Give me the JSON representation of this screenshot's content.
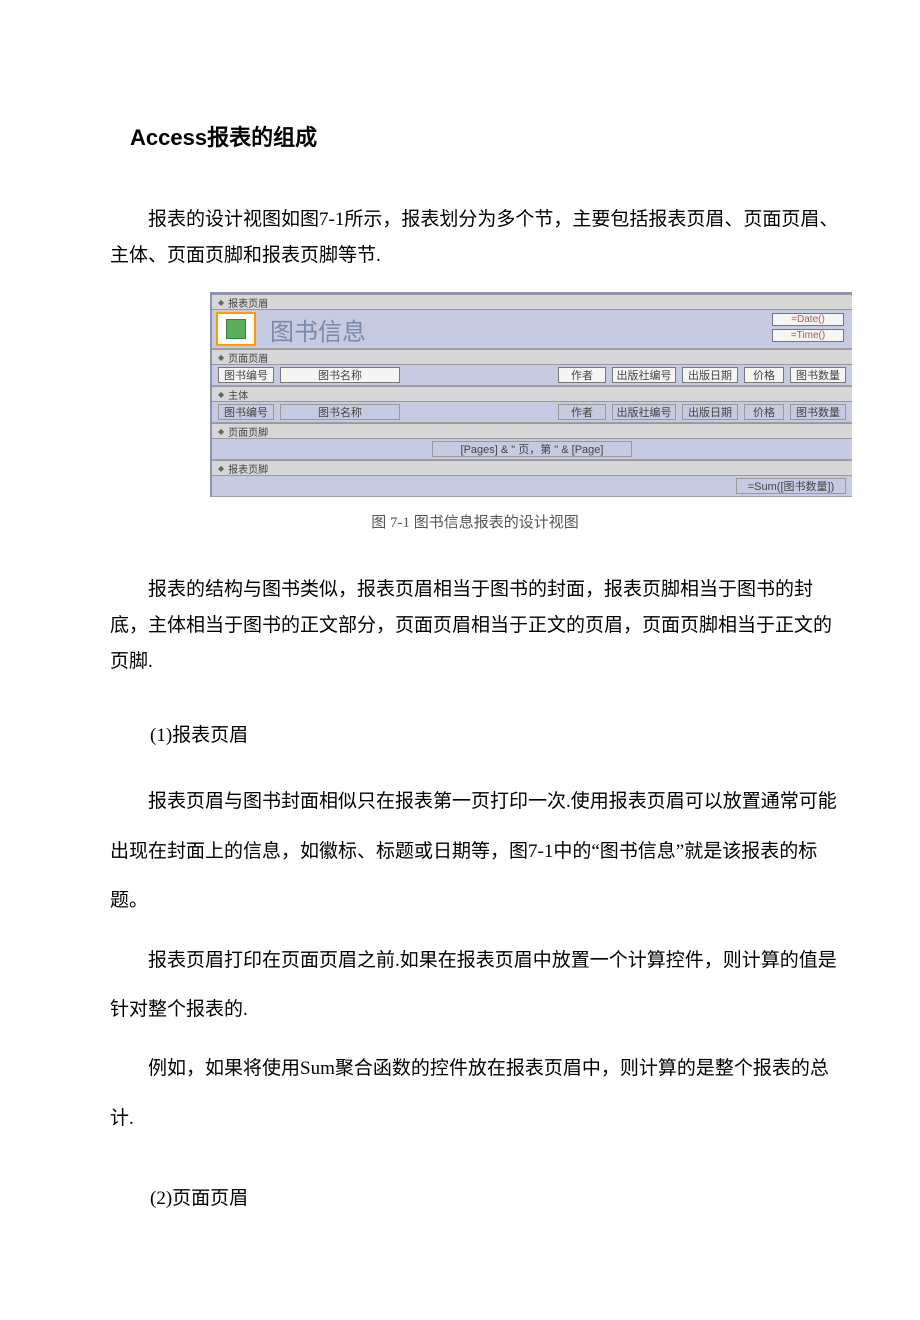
{
  "title": "Access报表的组成",
  "intro": "报表的设计视图如图7-1所示，报表划分为多个节，主要包括报表页眉、页面页眉、主体、页面页脚和报表页脚等节.",
  "figure": {
    "sections": {
      "report_header": "报表页眉",
      "page_header": "页面页眉",
      "detail": "主体",
      "page_footer": "页面页脚",
      "report_footer": "报表页脚"
    },
    "report_header": {
      "title": "图书信息",
      "date_expr": "=Date()",
      "time_expr": "=Time()"
    },
    "page_header_fields": [
      "图书编号",
      "图书名称",
      "作者",
      "出版社编号",
      "出版日期",
      "价格",
      "图书数量"
    ],
    "detail_fields": [
      "图书编号",
      "图书名称",
      "作者",
      "出版社编号",
      "出版日期",
      "价格",
      "图书数量"
    ],
    "page_footer_expr": "[Pages] & \" 页，第 \" & [Page]",
    "report_footer_expr": "=Sum([图书数量])",
    "caption": "图 7-1  图书信息报表的设计视图"
  },
  "structure_para": "报表的结构与图书类似，报表页眉相当于图书的封面，报表页脚相当于图书的封底，主体相当于图书的正文部分，页面页眉相当于正文的页眉，页面页脚相当于正文的页脚.",
  "sec1_heading": "(1)报表页眉",
  "sec1_p1": "报表页眉与图书封面相似只在报表第一页打印一次.使用报表页眉可以放置通常可能出现在封面上的信息，如徽标、标题或日期等，图7-1中的“图书信息”就是该报表的标题。",
  "sec1_p2": "报表页眉打印在页面页眉之前.如果在报表页眉中放置一个计算控件，则计算的值是针对整个报表的.",
  "sec1_p3": "例如，如果将使用Sum聚合函数的控件放在报表页眉中，则计算的是整个报表的总计.",
  "sec2_heading": "(2)页面页眉"
}
